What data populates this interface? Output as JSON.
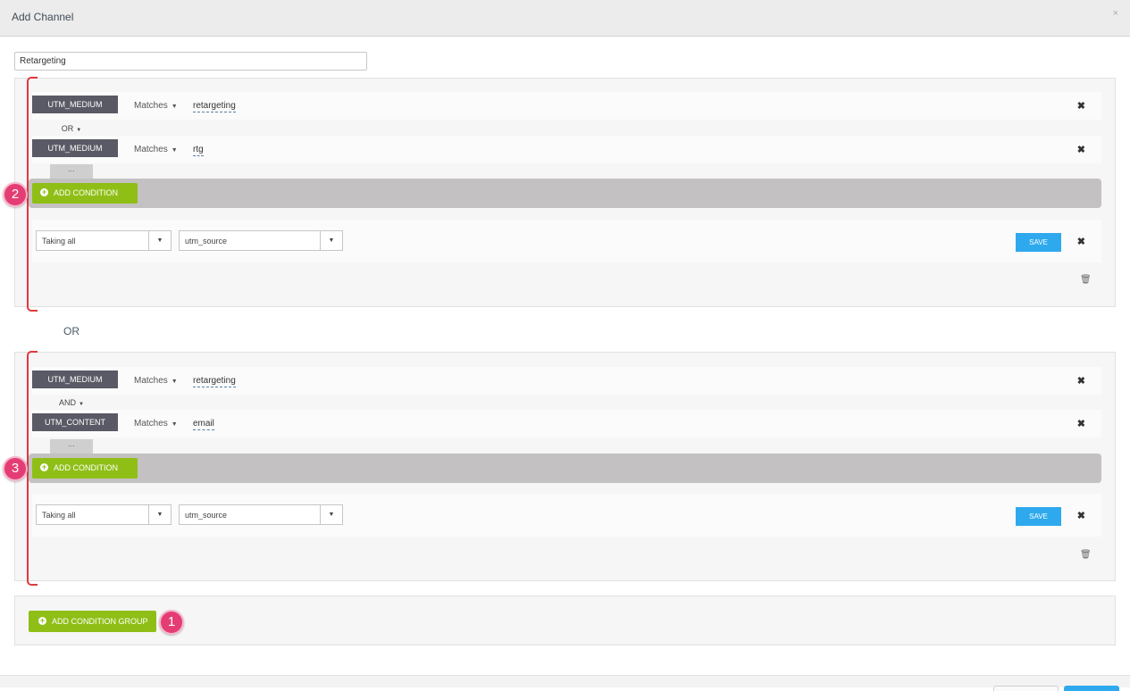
{
  "modal": {
    "title": "Add Channel",
    "close_icon": "×"
  },
  "channel_name": {
    "value": "Retargeting"
  },
  "groups": [
    {
      "conditions": [
        {
          "field": "UTM_MEDIUM",
          "operator": "Matches",
          "value": "retargeting"
        },
        {
          "field": "UTM_MEDIUM",
          "operator": "Matches",
          "value": "rtg"
        }
      ],
      "logic": "OR",
      "more": "...",
      "add_condition_label": "ADD CONDITION",
      "badge": "2",
      "output": {
        "taking": "Taking all",
        "source": "utm_source",
        "save_label": "SAVE"
      }
    },
    {
      "conditions": [
        {
          "field": "UTM_MEDIUM",
          "operator": "Matches",
          "value": "retargeting"
        },
        {
          "field": "UTM_CONTENT",
          "operator": "Matches",
          "value": "email"
        }
      ],
      "logic": "AND",
      "more": "...",
      "add_condition_label": "ADD CONDITION",
      "badge": "3",
      "output": {
        "taking": "Taking all",
        "source": "utm_source",
        "save_label": "SAVE"
      }
    }
  ],
  "group_separator": "OR",
  "footer": {
    "add_group_label": "ADD CONDITION GROUP",
    "badge": "1"
  },
  "colors": {
    "accent_green": "#8fbf16",
    "save_blue": "#2ea9ee",
    "badge_pink": "#e43d74",
    "bracket_red": "#e0393e",
    "field_tag": "#5a5a66"
  }
}
